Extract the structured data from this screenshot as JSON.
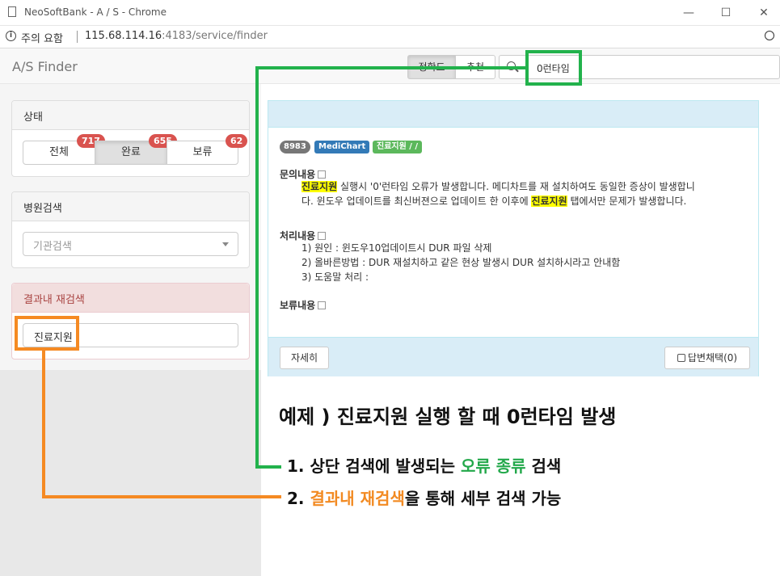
{
  "window": {
    "title": "NeoSoftBank - A / S - Chrome"
  },
  "address": {
    "security_text": "주의 요함",
    "url_host": "115.68.114.16",
    "url_rest": ":4183/service/finder"
  },
  "navbar": {
    "brand": "A/S Finder",
    "sort_buttons": [
      "정확도",
      "추천"
    ],
    "search_value": "0런타임"
  },
  "sidebar": {
    "status_panel": {
      "title": "상태",
      "buttons": [
        {
          "label": "전체",
          "count": "717"
        },
        {
          "label": "완료",
          "count": "655"
        },
        {
          "label": "보류",
          "count": "62"
        }
      ]
    },
    "hospital_panel": {
      "title": "병원검색",
      "placeholder": "기관검색"
    },
    "refine_panel": {
      "title": "결과내 재검색",
      "value": "진료지원"
    }
  },
  "card": {
    "labels": [
      "8983",
      "MediChart",
      "진료지원 / /"
    ],
    "inquiry": {
      "heading": "문의내용",
      "line1_hl": "진료지원",
      "line1_rest": " 실행시 '0'런타임 오류가 발생합니다. 메디차트를 재 설치하여도 동일한 증상이 발생합니",
      "line2_pre": "다. 윈도우 업데이트를 최신버젼으로 업데이트 한 이후에 ",
      "line2_hl": "진료지원",
      "line2_post": " 탭에서만 문제가 발생합니다."
    },
    "processing": {
      "heading": "처리내용",
      "lines": [
        "1) 원인 : 윈도우10업데이트시 DUR 파일 삭제",
        "2) 올바른방법 : DUR 재설치하고 같은 현상 발생시 DUR 설치하시라고 안내함",
        "3) 도움말 처리 :"
      ]
    },
    "hold": {
      "heading": "보류내용"
    },
    "detail_button": "자세히",
    "answer_button": "답변채택(0)"
  },
  "annotation": {
    "title": "예제 ) 진료지원 실행 할 때 0런타임 발생",
    "step1_pre": "1. 상단 검색에 발생되는 ",
    "step1_hl": "오류 종류",
    "step1_post": " 검색",
    "step2_hl": "2. 결과내 재검색",
    "step2_post": "을 통해 세부 검색 가능",
    "step2_num": "2. ",
    "step2_word": "결과내 재검색",
    "colors": {
      "green": "#22b24c",
      "orange": "#f58a23"
    }
  }
}
